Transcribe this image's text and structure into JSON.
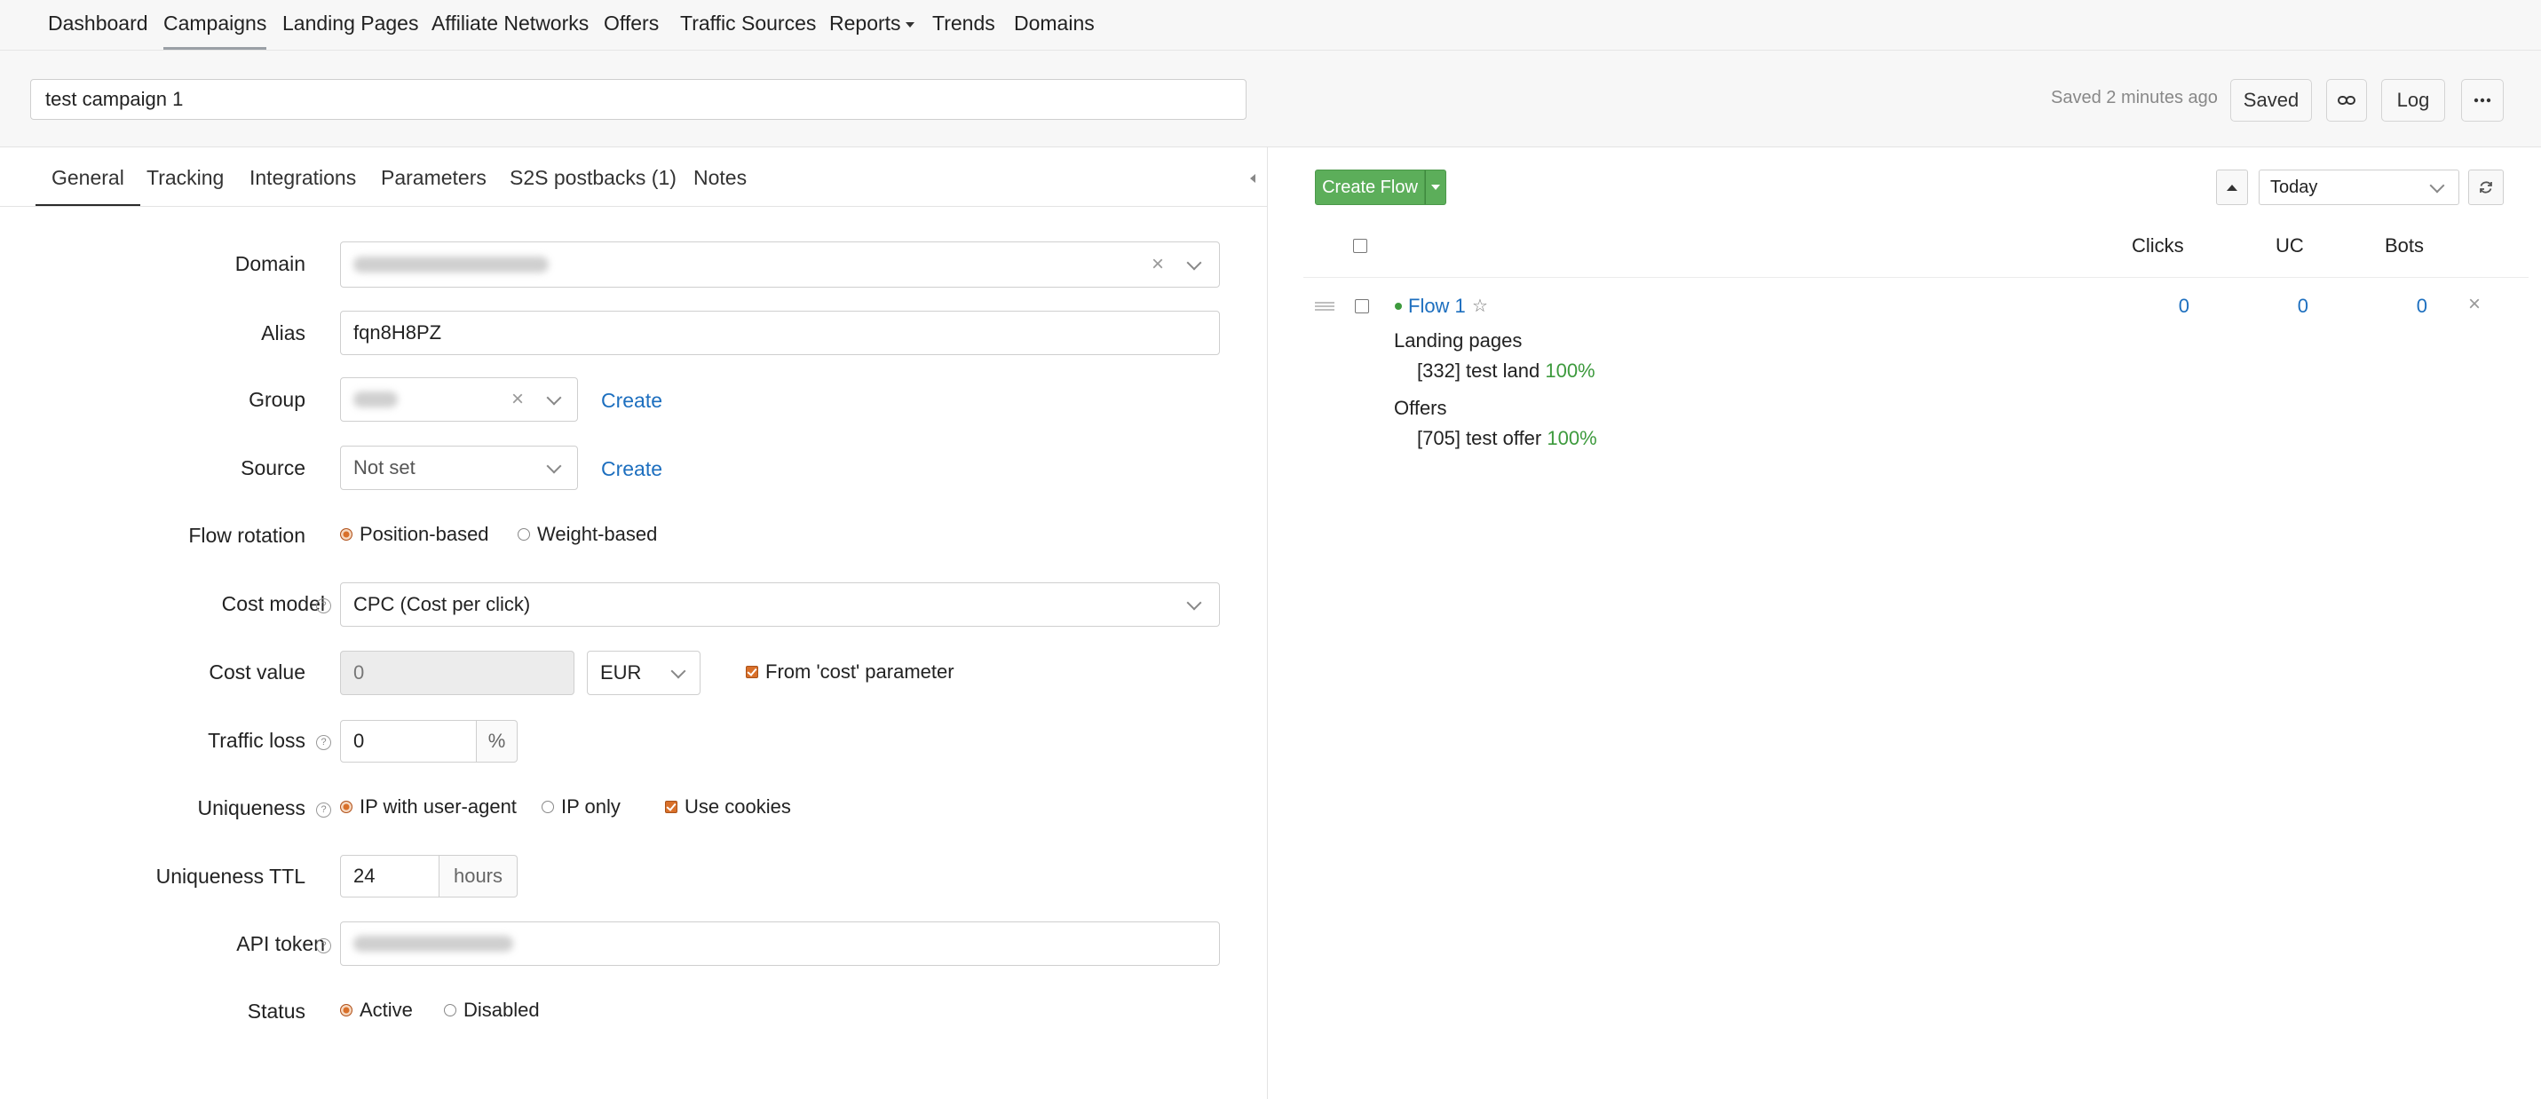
{
  "nav": {
    "items": [
      {
        "label": "Dashboard"
      },
      {
        "label": "Campaigns"
      },
      {
        "label": "Landing Pages"
      },
      {
        "label": "Affiliate Networks"
      },
      {
        "label": "Offers"
      },
      {
        "label": "Traffic Sources"
      },
      {
        "label": "Reports"
      },
      {
        "label": "Trends"
      },
      {
        "label": "Domains"
      }
    ],
    "active": "Campaigns"
  },
  "header": {
    "campaign_name": "test campaign 1",
    "saved_status": "Saved 2 minutes ago",
    "saved_button": "Saved",
    "link_icon": "link-icon",
    "log_button": "Log",
    "more_icon": "ellipsis-icon"
  },
  "tabs": [
    {
      "label": "General"
    },
    {
      "label": "Tracking"
    },
    {
      "label": "Integrations"
    },
    {
      "label": "Parameters"
    },
    {
      "label": "S2S postbacks (1)"
    },
    {
      "label": "Notes"
    }
  ],
  "form": {
    "domain": {
      "label": "Domain"
    },
    "alias": {
      "label": "Alias",
      "value": "fqn8H8PZ"
    },
    "group": {
      "label": "Group",
      "create": "Create"
    },
    "source": {
      "label": "Source",
      "value": "Not set",
      "create": "Create"
    },
    "flow_rotation": {
      "label": "Flow rotation",
      "options": [
        "Position-based",
        "Weight-based"
      ],
      "selected": "Position-based"
    },
    "cost_model": {
      "label": "Cost model",
      "value": "CPC (Cost per click)"
    },
    "cost_value": {
      "label": "Cost value",
      "value": "0",
      "currency": "EUR",
      "from_param_label": "From 'cost' parameter",
      "from_param_checked": true
    },
    "traffic_loss": {
      "label": "Traffic loss",
      "value": "0",
      "unit": "%"
    },
    "uniqueness": {
      "label": "Uniqueness",
      "options": [
        "IP with user-agent",
        "IP only"
      ],
      "selected": "IP with user-agent",
      "cookies_label": "Use cookies",
      "cookies_checked": true
    },
    "uniqueness_ttl": {
      "label": "Uniqueness TTL",
      "value": "24",
      "unit": "hours"
    },
    "api_token": {
      "label": "API token"
    },
    "status": {
      "label": "Status",
      "options": [
        "Active",
        "Disabled"
      ],
      "selected": "Active"
    }
  },
  "flows": {
    "create_button": "Create Flow",
    "period": "Today",
    "columns": [
      "Clicks",
      "UC",
      "Bots"
    ],
    "rows": [
      {
        "name": "Flow 1",
        "clicks": "0",
        "uc": "0",
        "bots": "0",
        "landing_heading": "Landing pages",
        "landing": {
          "name": "[332] test land",
          "share": "100%"
        },
        "offers_heading": "Offers",
        "offer": {
          "name": "[705] test offer",
          "share": "100%"
        }
      }
    ]
  },
  "colors": {
    "accent_green": "#5cae5a",
    "link_blue": "#1d6fbf",
    "radio_orange": "#d9702a",
    "percent_green": "#3d9a3d"
  }
}
